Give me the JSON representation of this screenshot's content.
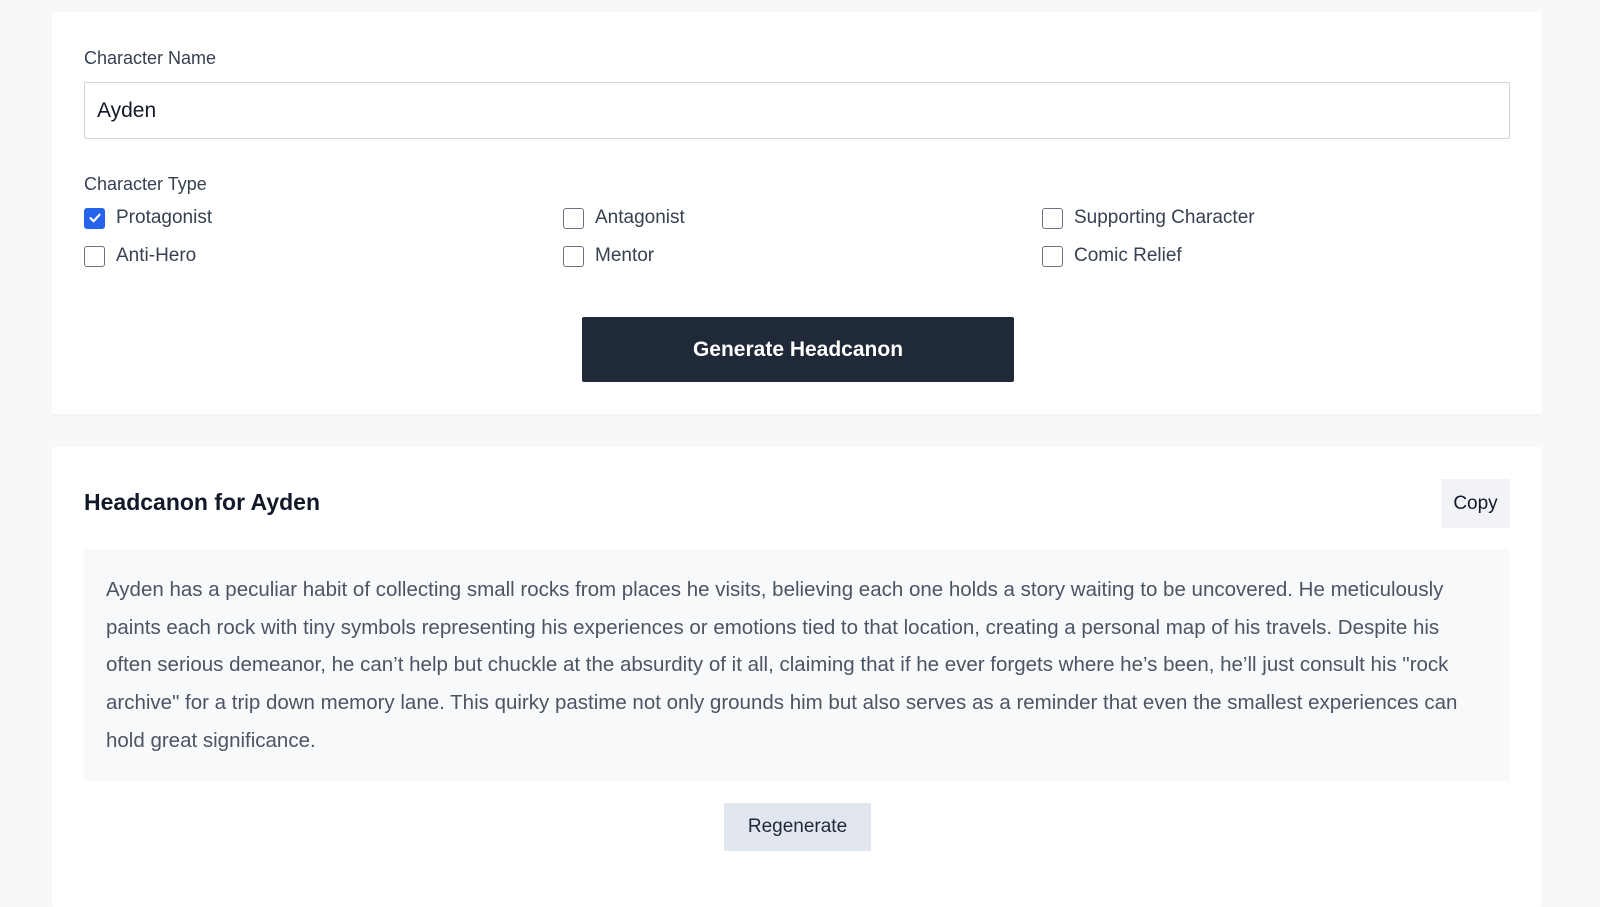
{
  "form": {
    "name_label": "Character Name",
    "name_value": "Ayden",
    "type_label": "Character Type",
    "options": [
      {
        "label": "Protagonist",
        "checked": true
      },
      {
        "label": "Antagonist",
        "checked": false
      },
      {
        "label": "Supporting Character",
        "checked": false
      },
      {
        "label": "Anti-Hero",
        "checked": false
      },
      {
        "label": "Mentor",
        "checked": false
      },
      {
        "label": "Comic Relief",
        "checked": false
      }
    ],
    "generate_label": "Generate Headcanon",
    "accent_color": "#2563eb",
    "button_color": "#1f2937"
  },
  "result": {
    "title": "Headcanon for Ayden",
    "copy_label": "Copy",
    "text": "Ayden has a peculiar habit of collecting small rocks from places he visits, believing each one holds a story waiting to be uncovered. He meticulously paints each rock with tiny symbols representing his experiences or emotions tied to that location, creating a personal map of his travels. Despite his often serious demeanor, he can’t help but chuckle at the absurdity of it all, claiming that if he ever forgets where he’s been, he’ll just consult his \"rock archive\" for a trip down memory lane. This quirky pastime not only grounds him but also serves as a reminder that even the smallest experiences can hold great significance.",
    "regenerate_label": "Regenerate"
  },
  "icons": {
    "checked": "checkmark-icon"
  }
}
